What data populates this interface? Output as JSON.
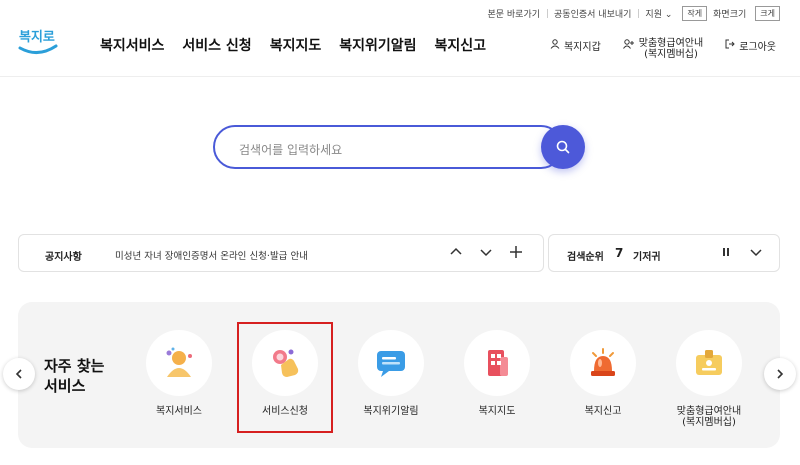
{
  "utility": {
    "skip_to_content": "본문 바로가기",
    "cert_export": "공동인증서 내보내기",
    "support": "지원",
    "screen_size_label": "화면크기",
    "small": "작게",
    "large": "크게"
  },
  "logo": {
    "text": "복지로",
    "color": "#2b9fd9"
  },
  "gnb": [
    "복지서비스",
    "서비스 신청",
    "복지지도",
    "복지위기알림",
    "복지신고"
  ],
  "header_right": {
    "wallet": "복지지갑",
    "membership_line1": "맞춤형급여안내",
    "membership_line2": "(복지멤버십)",
    "logout": "로그아웃"
  },
  "search": {
    "placeholder": "검색어를 입력하세요",
    "accent": "#4d59d9"
  },
  "notice": {
    "title": "공지사항",
    "text": "미성년 자녀 장애인증명서 온라인 신청·발급 안내"
  },
  "rank": {
    "title": "검색순위",
    "number": "7",
    "word": "기저귀"
  },
  "quick": {
    "title_line1": "자주 찾는",
    "title_line2": "서비스",
    "items": [
      {
        "label": "복지서비스",
        "icon": "person-icon"
      },
      {
        "label": "서비스신청",
        "icon": "hand-click-icon"
      },
      {
        "label": "복지위기알림",
        "icon": "chat-bubble-icon"
      },
      {
        "label": "복지지도",
        "icon": "building-icon"
      },
      {
        "label": "복지신고",
        "icon": "siren-icon"
      },
      {
        "label": "맞춤형급여안내",
        "label2": "(복지멤버십)",
        "icon": "membership-card-icon"
      }
    ]
  }
}
